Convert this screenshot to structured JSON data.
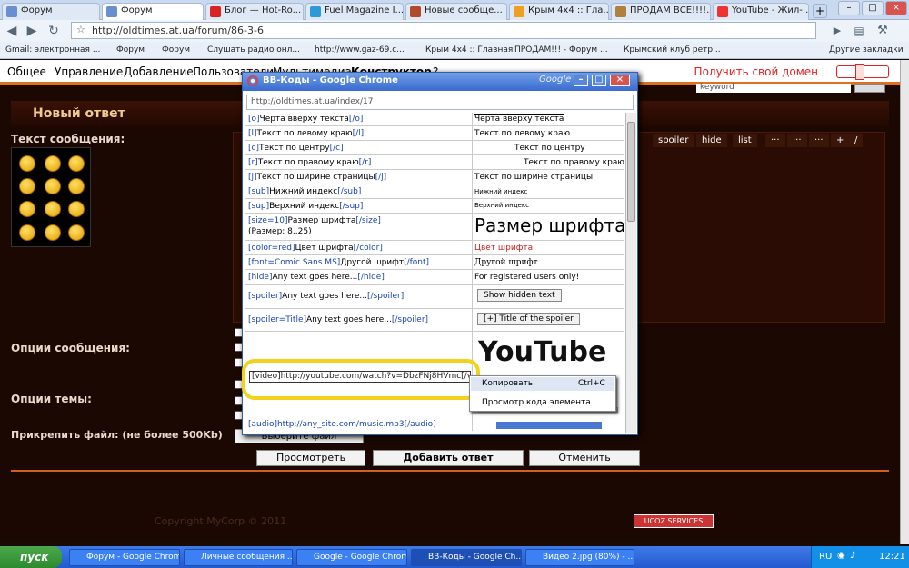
{
  "browser": {
    "tabs": [
      {
        "label": "Форум",
        "active": false
      },
      {
        "label": "Форум",
        "active": true
      },
      {
        "label": "Блог — Hot-Ro...",
        "active": false
      },
      {
        "label": "Fuel Magazine I...",
        "active": false
      },
      {
        "label": "Новые сообще...",
        "active": false
      },
      {
        "label": "Крым 4х4 :: Гла...",
        "active": false
      },
      {
        "label": "ПРОДАМ ВСЕ!!!!...",
        "active": false
      },
      {
        "label": "YouTube - Жил-...",
        "active": false
      }
    ],
    "url": "http://oldtimes.at.ua/forum/86-3-6",
    "bookmarks": [
      "Gmail: электронная ...",
      "Форум",
      "Форум",
      "Слушать радио онл...",
      "http://www.gaz-69.c...",
      "Крым 4х4 :: Главная",
      "ПРОДАМ!!! - Форум ...",
      "Крымский клуб ретр..."
    ],
    "other_bookmarks": "Другие закладки"
  },
  "site": {
    "menu": [
      "Общее",
      "Управление",
      "Добавление",
      "Пользователи",
      "Мультимедиа",
      "Конструктор",
      "?"
    ],
    "domain_link": "Получить свой домен",
    "keyword": "keyword",
    "heading": "Новый ответ",
    "message_label": "Текст сообщения:",
    "editor_buttons": [
      "spoiler",
      "hide",
      "list",
      "···",
      "···",
      "···",
      "+",
      "/"
    ],
    "message_options_label": "Опции сообщения:",
    "topic_options_label": "Опции темы:",
    "attach_label": "Прикрепить файл: (не более 500Kb)",
    "choose_file": "Выберите файл",
    "preview_button": "Просмотреть",
    "submit_button": "Добавить ответ",
    "cancel_button": "Отменить",
    "copyright": "Copyright MyCorp © 2011",
    "ucoz_badge": "UCOZ SERVICES"
  },
  "popup": {
    "title": "BB-Коды - Google Chrome",
    "google": "Google",
    "url": "http://oldtimes.at.ua/index/17",
    "rows": [
      {
        "open": "[o]",
        "text": "Черта вверху текста",
        "close": "[/o]",
        "result": "Черта вверху текста"
      },
      {
        "open": "[l]",
        "text": "Текст по левому краю",
        "close": "[/l]",
        "result": "Текст по левому краю"
      },
      {
        "open": "[c]",
        "text": "Текст по центру",
        "close": "[/c]",
        "result": "Текст по центру"
      },
      {
        "open": "[r]",
        "text": "Текст по правому краю",
        "close": "[/r]",
        "result": "Текст по правому краю"
      },
      {
        "open": "[j]",
        "text": "Текст по ширине страницы",
        "close": "[/j]",
        "result": "Текст по ширине страницы"
      },
      {
        "open": "[sub]",
        "text": "Нижний индекс",
        "close": "[/sub]",
        "result": "Нижний индекс"
      },
      {
        "open": "[sup]",
        "text": "Верхний индекс",
        "close": "[/sup]",
        "result": "Верхний индекс"
      },
      {
        "open": "[size=10]",
        "text": "Размер шрифта",
        "close": "[/size]",
        "note": "(Размер: 8..25)",
        "result": "Размер шрифта"
      },
      {
        "open": "[color=red]",
        "text": "Цвет шрифта",
        "close": "[/color]",
        "result": "Цвет шрифта"
      },
      {
        "open": "[font=Comic Sans MS]",
        "text": "Другой шрифт",
        "close": "[/font]",
        "result": "Другой шрифт"
      },
      {
        "open": "[hide]",
        "text": "Any text goes here...",
        "close": "[/hide]",
        "result": "For registered users only!"
      },
      {
        "open": "[spoiler]",
        "text": "Any text goes here...",
        "close": "[/spoiler]",
        "result": "Show hidden text"
      },
      {
        "open": "[spoiler=Title]",
        "text": "Any text goes here...",
        "close": "[/spoiler]",
        "result": "[+] Title of the spoiler"
      }
    ],
    "video_code": "[video]http://youtube.com/watch?v=DbzFNj8HVmc[/video]",
    "audio_code": "[audio]http://any_site.com/music.mp3[/audio]",
    "youtube_text": "YouTube",
    "context_menu": {
      "copy": "Копировать",
      "copy_shortcut": "Ctrl+C",
      "inspect": "Просмотр кода элемента"
    }
  },
  "taskbar": {
    "start": "пуск",
    "tasks": [
      {
        "label": "Форум - Google Chrome",
        "active": false
      },
      {
        "label": "Личные сообщения ...",
        "active": false
      },
      {
        "label": "Google - Google Chrome",
        "active": false
      },
      {
        "label": "BB-Коды - Google Ch...",
        "active": true
      },
      {
        "label": "Видео 2.jpg (80%) - ...",
        "active": false
      }
    ],
    "lang": "RU",
    "time": "12:21"
  },
  "colors": {
    "accent": "#e07020",
    "popup_title": "#3a6bd0",
    "highlight": "#f2d21a",
    "link": "#1a44b0",
    "red_text": "#cc2222"
  }
}
